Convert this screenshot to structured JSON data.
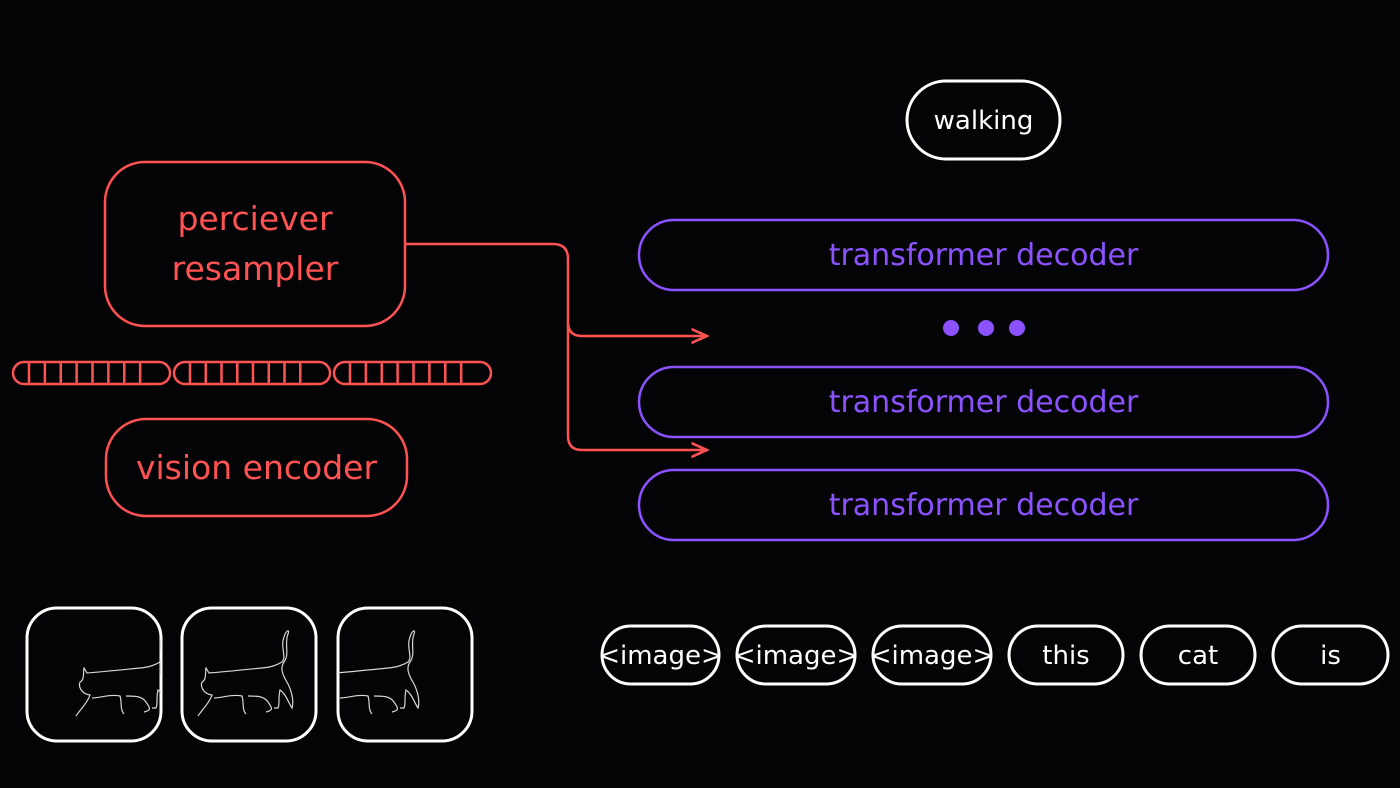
{
  "colors": {
    "background": "#040406",
    "vision_path": "#ff5252",
    "decoder": "#8c52ff",
    "text_tokens": "#ffffff"
  },
  "output_token": "walking",
  "perceiver": {
    "line1": "perciever",
    "line2": "resampler"
  },
  "vision_encoder": "vision encoder",
  "decoders": [
    "transformer decoder",
    "transformer decoder",
    "transformer decoder"
  ],
  "input_tokens": [
    "<image>",
    "<image>",
    "<image>",
    "this",
    "cat",
    "is"
  ],
  "images": [
    {
      "icon": "walking-cat-frame-1"
    },
    {
      "icon": "walking-cat-frame-2"
    },
    {
      "icon": "walking-cat-frame-3"
    }
  ]
}
